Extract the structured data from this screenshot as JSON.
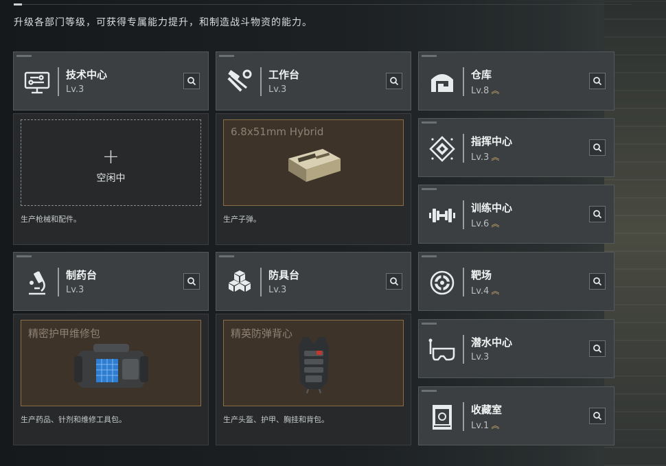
{
  "subtitle": "升级各部门等级，可获得专属能力提升，和制造战斗物资的能力。",
  "up_glyph": "︽",
  "big_panels": [
    {
      "name": "技术中心",
      "level": "Lv.3",
      "icon": "monitor-icon",
      "slot_state": "idle",
      "idle_text": "空闲中",
      "plus": "+",
      "desc": "生产枪械和配件。"
    },
    {
      "name": "工作台",
      "level": "Lv.3",
      "icon": "hammer-wrench-icon",
      "slot_state": "producing",
      "product": "6.8x51mm Hybrid",
      "desc": "生产子弹。"
    },
    {
      "name": "制药台",
      "level": "Lv.3",
      "icon": "microscope-icon",
      "slot_state": "producing",
      "product": "精密护甲维修包",
      "desc": "生产药品、针剂和维修工具包。"
    },
    {
      "name": "防具台",
      "level": "Lv.3",
      "icon": "cubes-icon",
      "slot_state": "producing",
      "product": "精英防弹背心",
      "desc": "生产头盔、护甲、胸挂和背包。"
    }
  ],
  "side_panels": [
    {
      "name": "仓库",
      "level": "Lv.8",
      "upgradable": true,
      "icon": "warehouse-icon"
    },
    {
      "name": "指挥中心",
      "level": "Lv.3",
      "upgradable": true,
      "icon": "command-diamond-icon"
    },
    {
      "name": "训练中心",
      "level": "Lv.6",
      "upgradable": true,
      "icon": "dumbbell-icon"
    },
    {
      "name": "靶场",
      "level": "Lv.4",
      "upgradable": true,
      "icon": "target-icon"
    },
    {
      "name": "潜水中心",
      "level": "Lv.3",
      "upgradable": false,
      "icon": "diving-mask-icon"
    },
    {
      "name": "收藏室",
      "level": "Lv.1",
      "upgradable": true,
      "icon": "collection-cabinet-icon"
    }
  ]
}
